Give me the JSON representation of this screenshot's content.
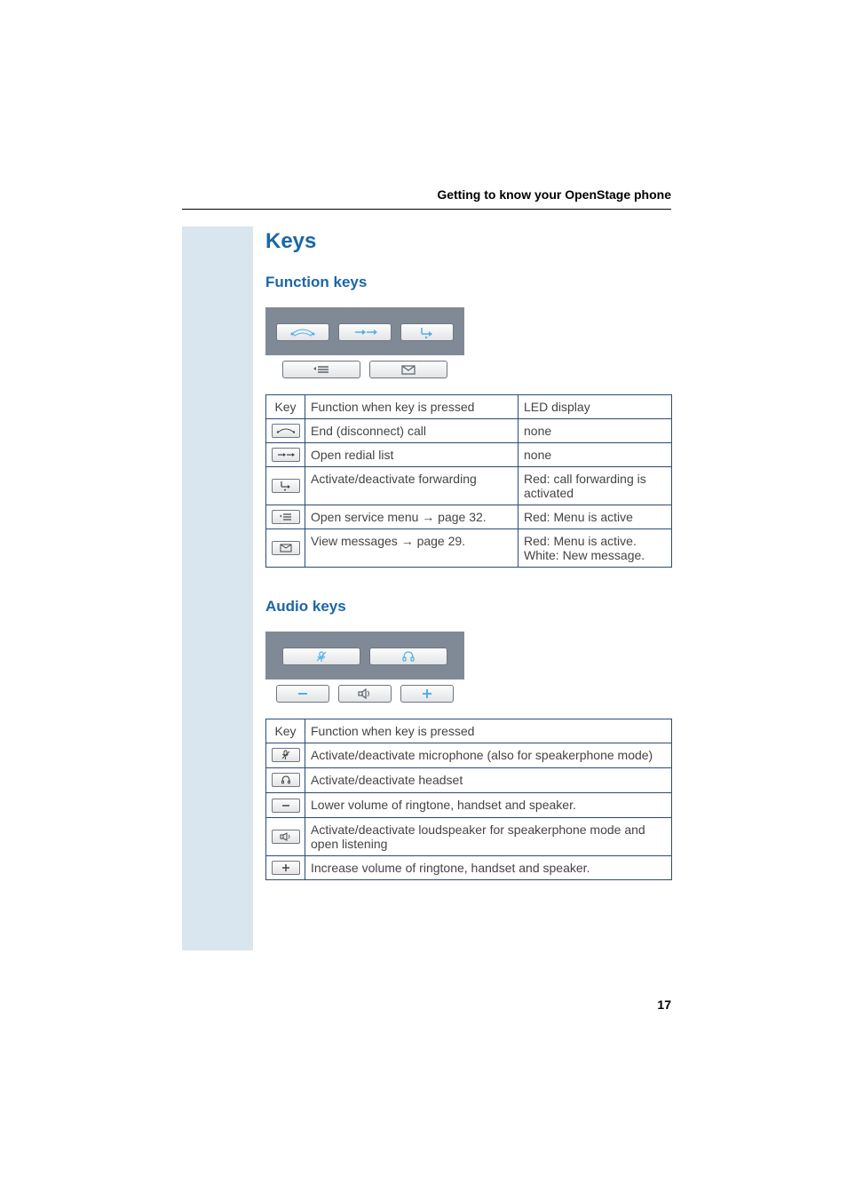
{
  "header": "Getting to know your OpenStage phone",
  "h1": "Keys",
  "section1": {
    "title": "Function keys",
    "table": {
      "headers": [
        "Key",
        "Function when key is pressed",
        "LED display"
      ],
      "rows": [
        {
          "icon": "end-call-icon",
          "fn": "End (disconnect) call",
          "led": "none"
        },
        {
          "icon": "redial-icon",
          "fn": "Open redial list",
          "led": "none"
        },
        {
          "icon": "forward-icon",
          "fn": "Activate/deactivate forwarding",
          "led": "Red: call forwarding is activated"
        },
        {
          "icon": "menu-icon",
          "fn_pre": "Open service menu ",
          "fn_post": " page 32.",
          "led": "Red: Menu is active"
        },
        {
          "icon": "message-icon",
          "fn_pre": "View messages ",
          "fn_post": " page 29.",
          "led": "Red: Menu is active. White: New message."
        }
      ]
    }
  },
  "section2": {
    "title": "Audio keys",
    "table": {
      "headers": [
        "Key",
        "Function when key is pressed"
      ],
      "rows": [
        {
          "icon": "mic-mute-icon",
          "fn": "Activate/deactivate microphone (also for speakerphone mode)"
        },
        {
          "icon": "headset-icon",
          "fn": "Activate/deactivate headset"
        },
        {
          "icon": "minus-icon",
          "fn": "Lower volume of ringtone, handset and speaker."
        },
        {
          "icon": "speaker-icon",
          "fn": "Activate/deactivate loudspeaker for speakerphone mode and open listening"
        },
        {
          "icon": "plus-icon",
          "fn": "Increase volume of ringtone, handset and speaker."
        }
      ]
    }
  },
  "page_number": "17"
}
